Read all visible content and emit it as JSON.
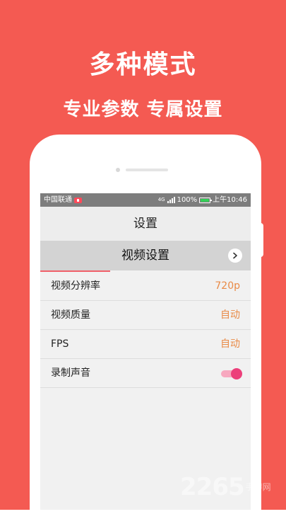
{
  "promo": {
    "headline": "多种模式",
    "subline": "专业参数 专属设置"
  },
  "statusbar": {
    "carrier": "中国联通",
    "network": "4G",
    "battery": "100%",
    "time": "上午10:46"
  },
  "screen": {
    "title": "设置",
    "section": {
      "label": "视频设置",
      "nav_icon": "chevron-right-icon"
    },
    "rows": [
      {
        "label": "视频分辨率",
        "value": "720p"
      },
      {
        "label": "视频质量",
        "value": "自动"
      },
      {
        "label": "FPS",
        "value": "自动"
      },
      {
        "label": "录制声音",
        "toggle": true
      }
    ]
  },
  "watermark": {
    "number": "2265",
    "text": "手游网"
  },
  "colors": {
    "background": "#f45a52",
    "accent_value": "#e98a46",
    "toggle_on": "#ec3f7a",
    "underline": "#f0606a"
  }
}
